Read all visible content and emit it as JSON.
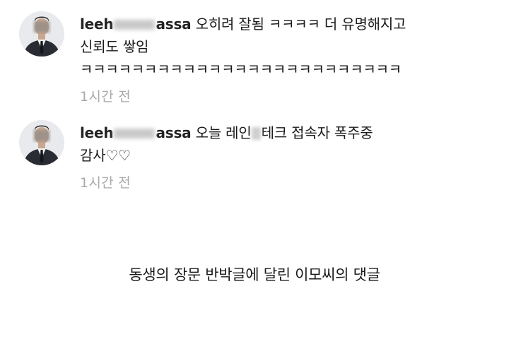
{
  "comments": [
    {
      "username_start": "leeh",
      "username_end": "assa",
      "line1": "오히려 잘됨 ㅋㅋㅋㅋ 더 유명해지고",
      "line2": "신뢰도 쌓임",
      "line3": "ㅋㅋㅋㅋㅋㅋㅋㅋㅋㅋㅋㅋㅋㅋㅋㅋㅋㅋㅋㅋㅋㅋㅋㅋㅋ",
      "time": "1시간 전"
    },
    {
      "username_start": "leeh",
      "username_end": "assa",
      "line1_before": "오늘 레인",
      "line1_after": "테크 접속자 폭주중",
      "line2": "감사♡♡",
      "time": "1시간 전"
    }
  ],
  "caption": "동생의 장문 반박글에 달린 이모씨의 댓글",
  "colors": {
    "background": "#ffffff",
    "text": "#1a1a1a",
    "timestamp": "#a9a9a9"
  }
}
